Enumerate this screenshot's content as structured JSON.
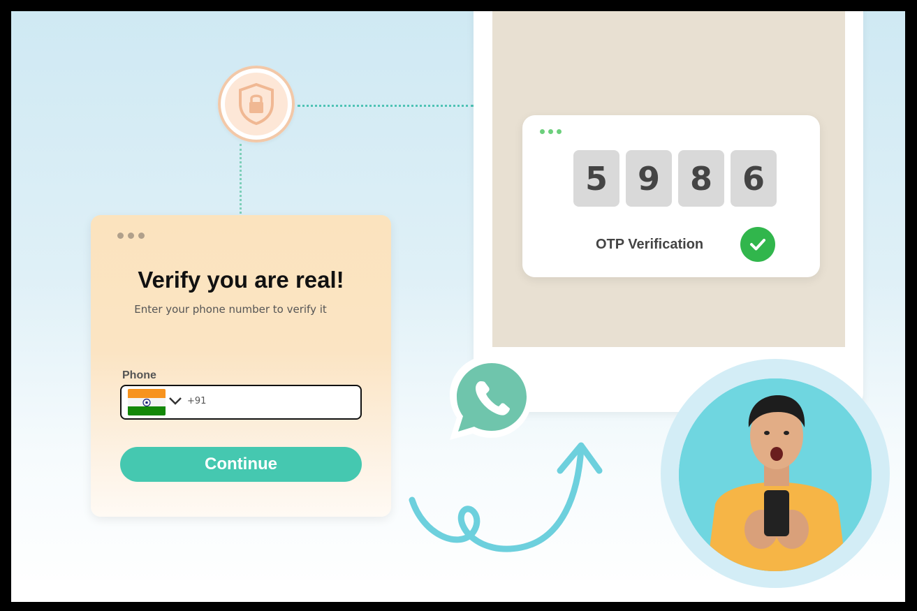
{
  "verify": {
    "title": "Verify you are real!",
    "subtitle": "Enter your phone number to verify it",
    "phone_label": "Phone",
    "country_code": "+91",
    "continue_label": "Continue"
  },
  "otp": {
    "digits": [
      "5",
      "9",
      "8",
      "6"
    ],
    "label": "OTP Verification"
  },
  "icons": {
    "lock": "shield-lock-icon",
    "whatsapp": "whatsapp-icon",
    "check": "check-icon",
    "flag": "india-flag-icon",
    "chevron": "chevron-down-icon"
  },
  "colors": {
    "accent": "#45c8b0",
    "success": "#31b64c",
    "whatsapp": "#6fc5ac"
  }
}
